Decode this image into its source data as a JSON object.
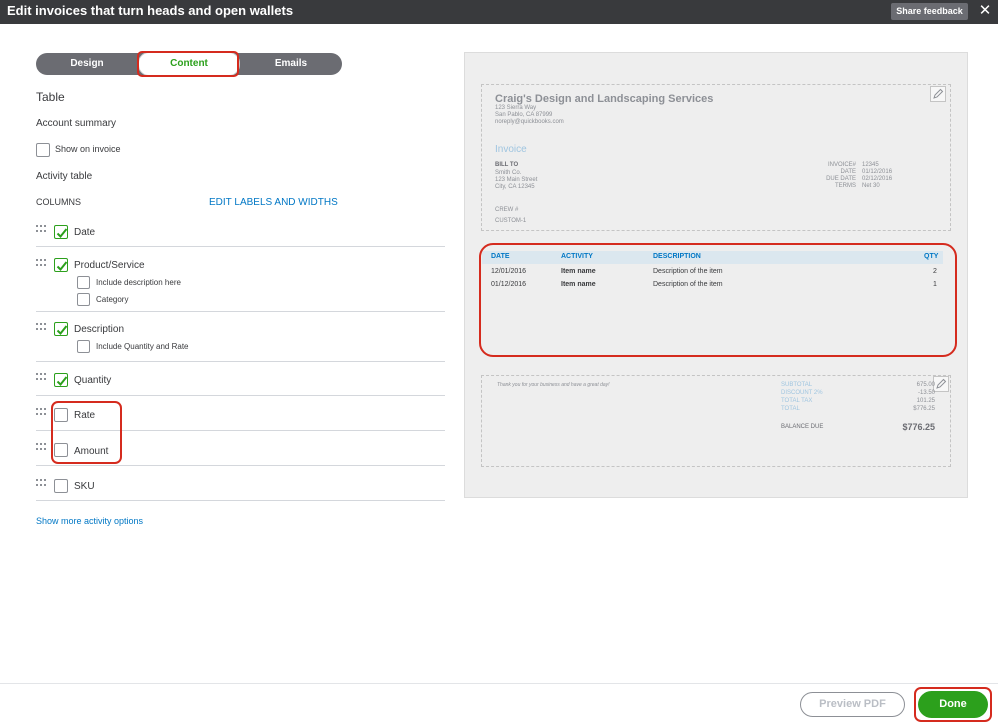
{
  "header": {
    "title": "Edit invoices that turn heads and open wallets",
    "share_feedback": "Share feedback",
    "close_glyph": "✕",
    "close_icon": "close-icon"
  },
  "tabs": [
    {
      "label": "Design",
      "selected": false
    },
    {
      "label": "Content",
      "selected": true
    },
    {
      "label": "Emails",
      "selected": false
    }
  ],
  "left": {
    "section_title": "Table",
    "account_summary_label": "Account summary",
    "show_on_invoice_label": "Show on invoice",
    "show_on_invoice_checked": false,
    "activity_table_label": "Activity table",
    "columns_label": "COLUMNS",
    "edit_labels_link": "EDIT LABELS AND WIDTHS",
    "columns": [
      {
        "label": "Date",
        "checked": true
      },
      {
        "label": "Product/Service",
        "checked": true,
        "sub_options": [
          {
            "label": "Include description here",
            "checked": false
          },
          {
            "label": "Category",
            "checked": false
          }
        ]
      },
      {
        "label": "Description",
        "checked": true,
        "sub_options": [
          {
            "label": "Include Quantity and Rate",
            "checked": false
          }
        ]
      },
      {
        "label": "Quantity",
        "checked": true
      },
      {
        "label": "Rate",
        "checked": false
      },
      {
        "label": "Amount",
        "checked": false
      },
      {
        "label": "SKU",
        "checked": false
      }
    ],
    "show_more_link": "Show more activity options",
    "drag_icon": "drag-handle-icon",
    "check_icon": "checkmark-icon"
  },
  "preview": {
    "company_name": "Craig's Design and Landscaping Services",
    "address_line1": "123 Sierra Way",
    "address_line2": "San Pablo, CA 87999",
    "email": "noreply@quickbooks.com",
    "invoice_title": "Invoice",
    "bill_to_label": "BILL TO",
    "bill_to_lines": [
      "Smith Co.",
      "123 Main Street",
      "City, CA 12345"
    ],
    "meta": [
      {
        "label": "INVOICE#",
        "value": "12345"
      },
      {
        "label": "DATE",
        "value": "01/12/2016"
      },
      {
        "label": "DUE DATE",
        "value": "02/12/2016"
      },
      {
        "label": "TERMS",
        "value": "Net 30"
      }
    ],
    "crew_label": "CREW #",
    "custom_label": "CUSTOM-1",
    "table_headers": [
      "DATE",
      "ACTIVITY",
      "DESCRIPTION",
      "QTY"
    ],
    "table_rows": [
      {
        "date": "12/01/2016",
        "activity": "Item name",
        "description": "Description of the item",
        "qty": "2"
      },
      {
        "date": "01/12/2016",
        "activity": "Item name",
        "description": "Description of the item",
        "qty": "1"
      }
    ],
    "thank_you": "Thank you for your business and have a great day!",
    "totals": [
      {
        "label": "SUBTOTAL",
        "value": "675.00"
      },
      {
        "label": "DISCOUNT 2%",
        "value": "-13.50"
      },
      {
        "label": "TOTAL TAX",
        "value": "101.25"
      },
      {
        "label": "TOTAL",
        "value": "$776.25"
      }
    ],
    "balance_due_label": "BALANCE DUE",
    "balance_due_value": "$776.25",
    "edit_icon": "pencil-icon"
  },
  "footer": {
    "preview_pdf": "Preview PDF",
    "done": "Done"
  },
  "colors": {
    "header_bg": "#393a3d",
    "accent_green": "#2ca01c",
    "link_blue": "#0077c5",
    "highlight_red": "#d52b1e"
  }
}
